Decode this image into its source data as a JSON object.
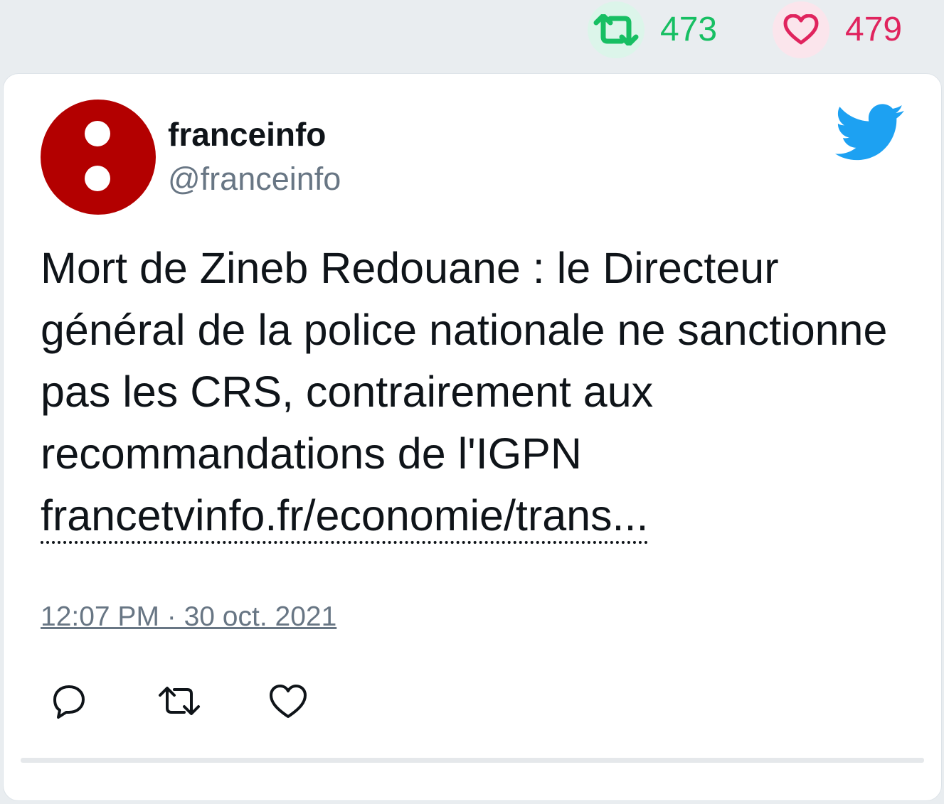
{
  "header": {
    "retweet_count": "473",
    "like_count": "479"
  },
  "tweet": {
    "author_name": "franceinfo",
    "author_handle": "@franceinfo",
    "text": "Mort de Zineb Redouane : le Directeur général de la police nationale ne sanctionne pas les CRS, contrairement aux recommandations de l'IGPN",
    "link_text": "francetvinfo.fr/economie/trans...",
    "timestamp": "12:07 PM · 30 oct. 2021"
  },
  "icons": {
    "retweet": "retweet-icon",
    "like": "heart-icon",
    "reply": "reply-icon",
    "brand": "twitter-bird-icon",
    "avatar": "franceinfo-logo"
  },
  "colors": {
    "retweet_green": "#17bf63",
    "like_red": "#e0245e",
    "twitter_blue": "#1da1f2",
    "avatar_red": "#b30000"
  }
}
